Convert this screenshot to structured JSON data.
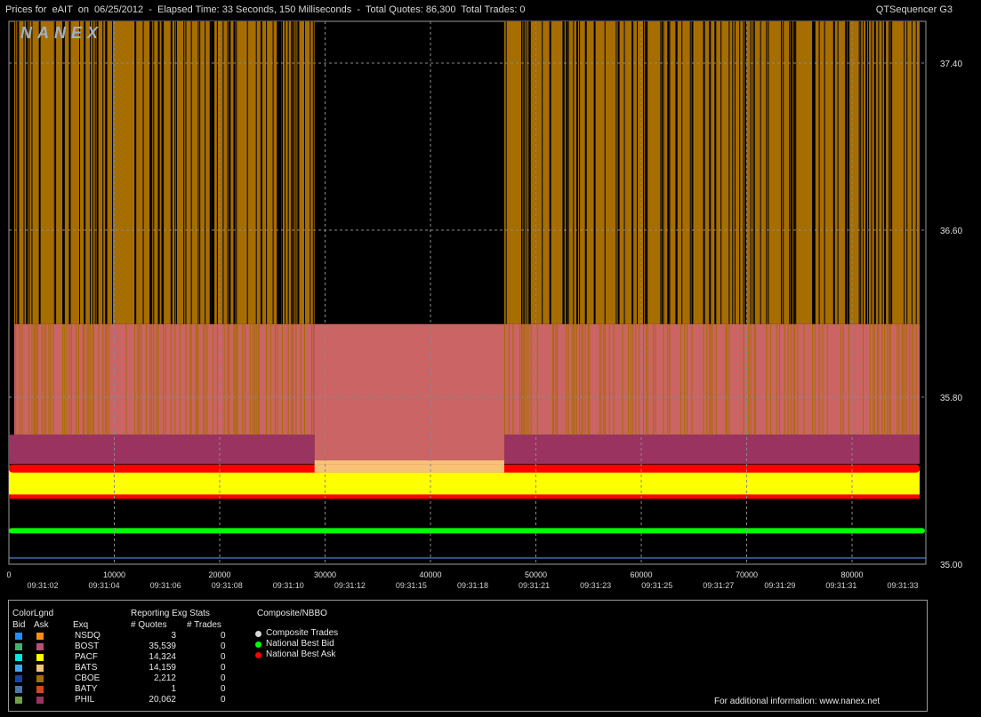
{
  "header": {
    "title": "Prices for  eAIT  on  06/25/2012  -  Elapsed Time: 33 Seconds, 150 Milliseconds  -  Total Quotes: 86,300  Total Trades: 0",
    "app": "QTSequencer G3"
  },
  "logo_text": "NANEX",
  "colors": {
    "background": "#000000",
    "boston": "#A66D00",
    "bats": "#CB6464",
    "phil": "#9A3360",
    "batsbid": "#F6C377",
    "best_ask": "#FF0000",
    "pacf_yellow": "#FFFF00",
    "best_bid": "#00FF00",
    "grid": "#8a8a8a"
  },
  "chart_data": {
    "type": "line",
    "title": "Prices for eAIT on 06/25/2012",
    "x_axis": {
      "range": [
        0,
        87000
      ],
      "ticks": [
        0,
        10000,
        20000,
        30000,
        40000,
        50000,
        60000,
        70000,
        80000
      ],
      "time_labels": [
        "09:31:02",
        "09:31:04",
        "09:31:06",
        "09:31:08",
        "09:31:10",
        "09:31:12",
        "09:31:15",
        "09:31:18",
        "09:31:21",
        "09:31:23",
        "09:31:25",
        "09:31:27",
        "09:31:29",
        "09:31:31",
        "09:31:33"
      ]
    },
    "y_axis": {
      "range": [
        35.0,
        37.6
      ],
      "ticks": [
        35.0,
        35.8,
        36.6,
        37.4
      ],
      "tick_labels": [
        "35.00",
        "35.80",
        "36.60",
        "37.40"
      ]
    },
    "gap_range": [
      29000,
      47000
    ],
    "series": [
      {
        "name": "BOST",
        "side": "ask",
        "range": [
          35.8,
          37.6
        ],
        "color": "#A66D00",
        "note_count": 35539
      },
      {
        "name": "BATS",
        "side": "ask",
        "range": [
          35.62,
          36.15
        ],
        "color": "#CB6464"
      },
      {
        "name": "PHIL",
        "side": "ask",
        "range": [
          35.48,
          35.62
        ],
        "color": "#9A3360"
      },
      {
        "name": "National Best Ask",
        "value": 35.46,
        "color": "#FF0000"
      },
      {
        "name": "PACF",
        "side": "bid",
        "range": [
          35.33,
          35.45
        ],
        "color": "#FFFF00"
      },
      {
        "name": "National Best Bid",
        "value": 35.16,
        "color": "#00FF00"
      }
    ]
  },
  "legend": {
    "col_colorlgnd": "ColorLgnd",
    "col_bid": "Bid",
    "col_ask": "Ask",
    "col_exq": "Exq",
    "col_stats": "Reporting Exg Stats",
    "col_quotes": "# Quotes",
    "col_trades": "# Trades",
    "col_composite": "Composite/NBBO",
    "rows": [
      {
        "exg": "NSDQ",
        "quotes": "3",
        "trades": "0",
        "bid": "#1E90FF",
        "ask": "#FF8C1A"
      },
      {
        "exg": "BOST",
        "quotes": "35,539",
        "trades": "0",
        "bid": "#3CB371",
        "ask": "#B5507A"
      },
      {
        "exg": "PACF",
        "quotes": "14,324",
        "trades": "0",
        "bid": "#00E5E5",
        "ask": "#FFFF00"
      },
      {
        "exg": "BATS",
        "quotes": "14,159",
        "trades": "0",
        "bid": "#3FA9F5",
        "ask": "#F6C377"
      },
      {
        "exg": "CBOE",
        "quotes": "2,212",
        "trades": "0",
        "bid": "#1546A8",
        "ask": "#A66D00"
      },
      {
        "exg": "BATY",
        "quotes": "1",
        "trades": "0",
        "bid": "#4A77B0",
        "ask": "#D04A1E"
      },
      {
        "exg": "PHIL",
        "quotes": "20,062",
        "trades": "0",
        "bid": "#6FA04A",
        "ask": "#9A3360"
      }
    ],
    "composite": [
      {
        "label": "Composite Trades",
        "color": "#D8D8D8"
      },
      {
        "label": "National Best Bid",
        "color": "#00FF00"
      },
      {
        "label": "National Best Ask",
        "color": "#FF0000"
      }
    ],
    "footer": "For additional information: www.nanex.net"
  }
}
